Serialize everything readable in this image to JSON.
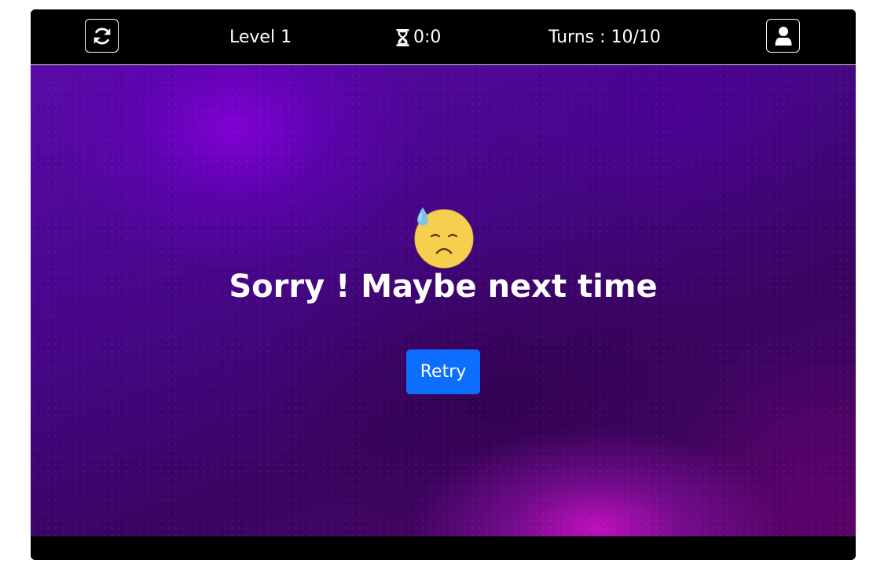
{
  "header": {
    "restart_icon": "restart-icon",
    "level_label": "Level 1",
    "timer_icon": "hourglass-icon",
    "timer_value": "0:0",
    "turns_label": "Turns : 10/10",
    "profile_icon": "user-icon"
  },
  "result": {
    "emoji_icon": "sad-but-relieved-face-icon",
    "message": "Sorry ! Maybe next time",
    "retry_label": "Retry"
  },
  "colors": {
    "bar_background": "#000000",
    "board_purple": "#47068a",
    "board_magenta": "#d412cd",
    "retry_button": "#0d6efd",
    "text": "#ffffff"
  }
}
